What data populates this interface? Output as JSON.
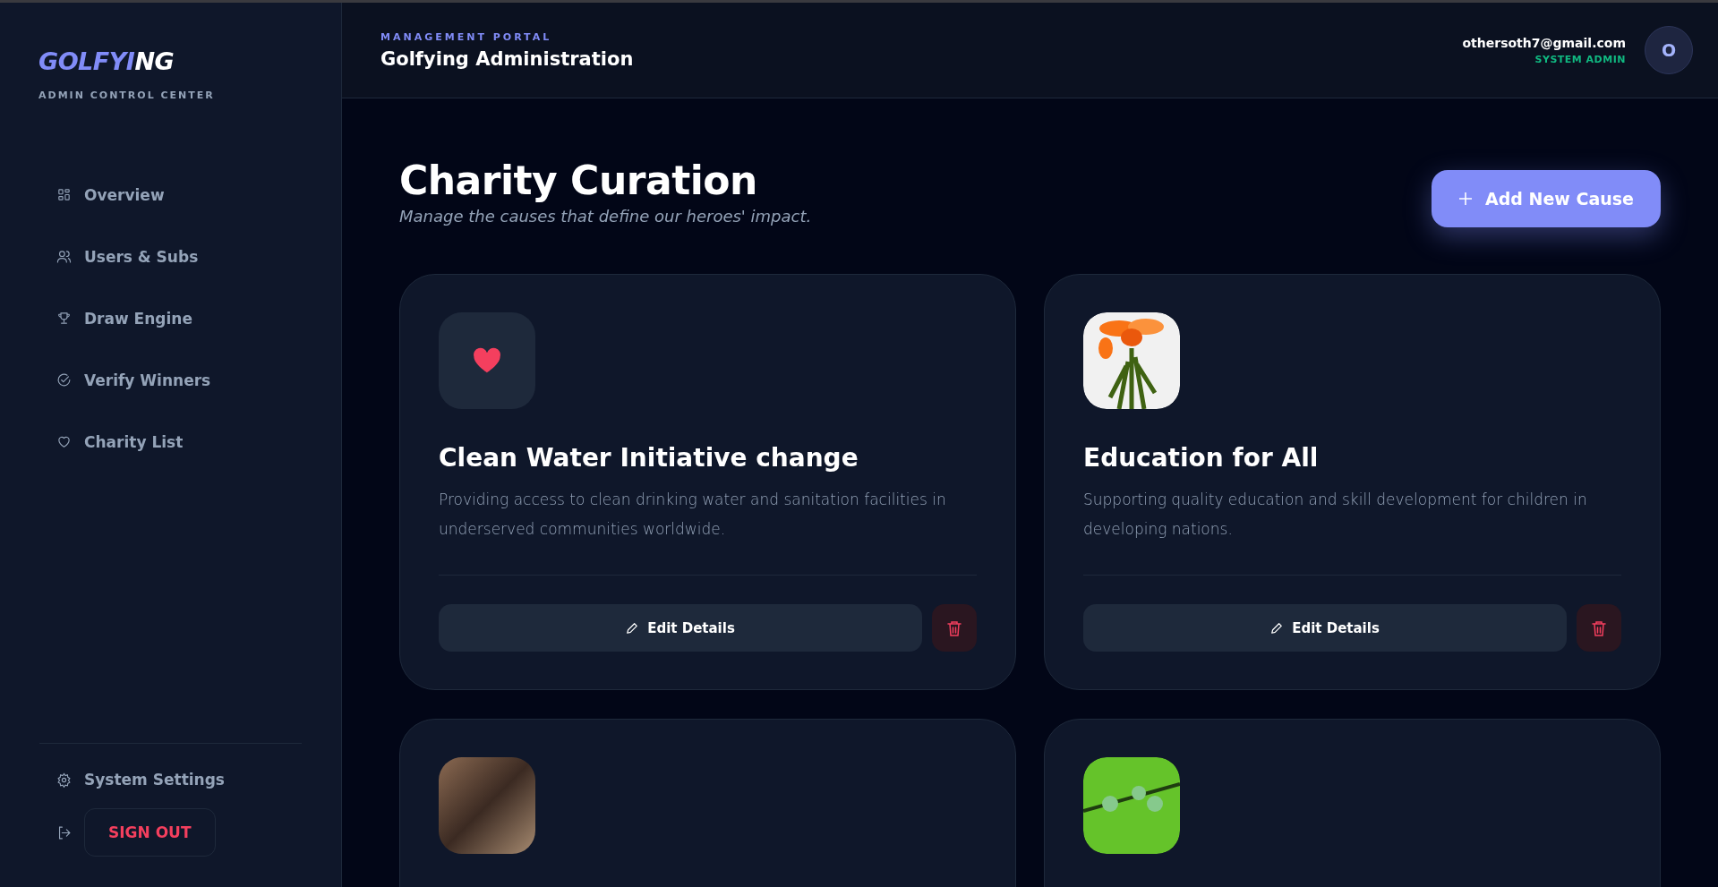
{
  "sidebar": {
    "logo": {
      "first": "GOLFYI",
      "second": "NG"
    },
    "subtitle": "ADMIN CONTROL CENTER",
    "items": [
      {
        "kind": "grid",
        "label": "Overview"
      },
      {
        "kind": "users",
        "label": "Users & Subs"
      },
      {
        "kind": "trophy",
        "label": "Draw Engine"
      },
      {
        "kind": "check",
        "label": "Verify Winners"
      },
      {
        "kind": "heart",
        "label": "Charity List"
      }
    ],
    "settings": {
      "label": "System Settings"
    },
    "sign_out": {
      "label": "SIGN OUT"
    }
  },
  "header": {
    "eyebrow": "MANAGEMENT PORTAL",
    "title": "Golfying Administration",
    "user": {
      "email": "othersoth7@gmail.com",
      "role": "SYSTEM ADMIN",
      "avatar": "O"
    }
  },
  "page": {
    "title": "Charity Curation",
    "subtitle": "Manage the causes that define our heroes' impact.",
    "add_button": "Add New Cause"
  },
  "causes": [
    {
      "kind": "heart",
      "title": "Clean Water Initiative change",
      "description": "Providing access to clean drinking water and sanitation facilities in underserved communities worldwide.",
      "edit": "Edit Details"
    },
    {
      "kind": "flower",
      "title": "Education for All",
      "description": "Supporting quality education and skill development for children in developing nations.",
      "edit": "Edit Details"
    },
    {
      "kind": "photo"
    },
    {
      "kind": "leaf"
    }
  ]
}
